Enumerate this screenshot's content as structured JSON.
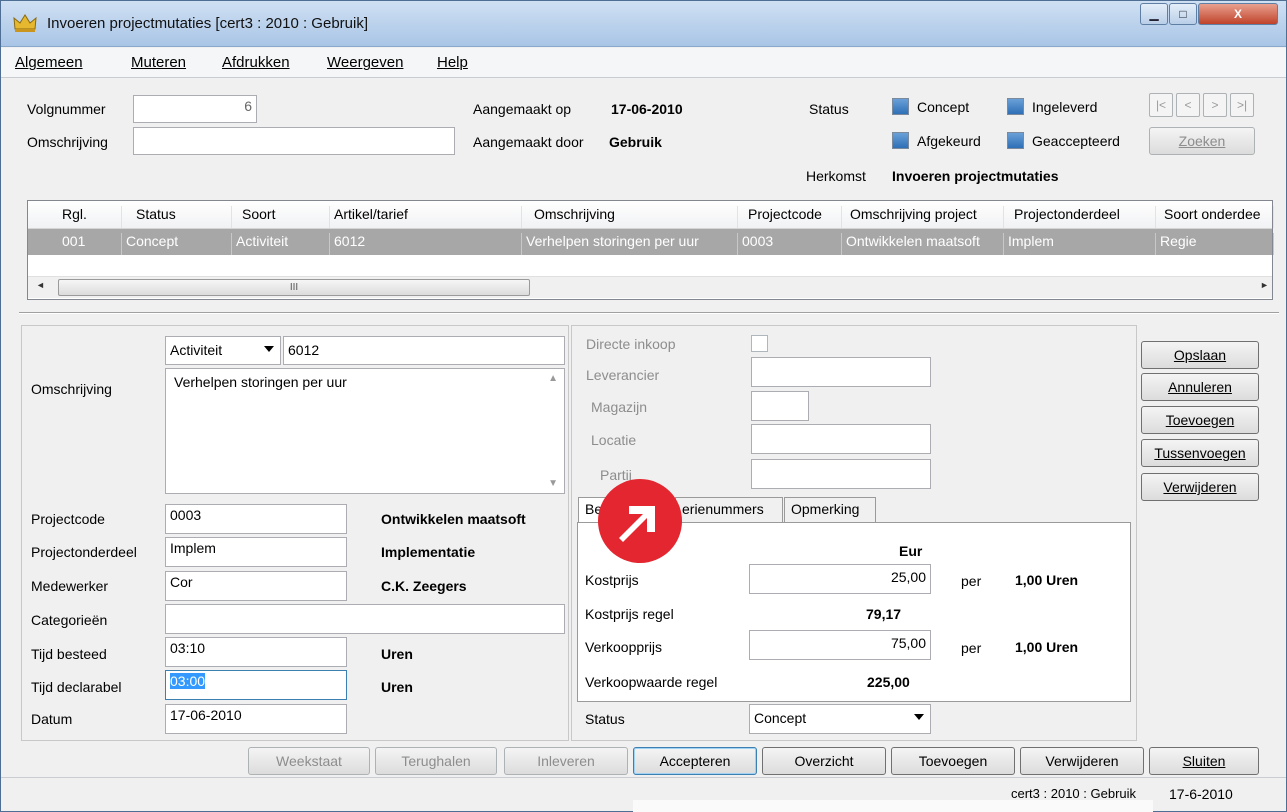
{
  "window": {
    "title": "Invoeren projectmutaties  [cert3 : 2010 : Gebruik]",
    "min_glyph": "▁",
    "max_glyph": "□",
    "close_glyph": "X"
  },
  "menu": [
    "Algemeen",
    "Muteren",
    "Afdrukken",
    "Weergeven",
    "Help"
  ],
  "header": {
    "volgnummer_label": "Volgnummer",
    "volgnummer_value": "6",
    "omschrijving_label": "Omschrijving",
    "omschrijving_value": "",
    "aangemaakt_op_label": "Aangemaakt op",
    "aangemaakt_op_value": "17-06-2010",
    "aangemaakt_door_label": "Aangemaakt door",
    "aangemaakt_door_value": "Gebruik",
    "status_label": "Status",
    "status_options": [
      "Concept",
      "Ingeleverd",
      "Afgekeurd",
      "Geaccepteerd"
    ],
    "herkomst_label": "Herkomst",
    "herkomst_value": "Invoeren projectmutaties",
    "zoeken_label": "Zoeken",
    "nav_buttons": [
      "|<",
      "<",
      ">",
      ">|"
    ]
  },
  "grid": {
    "columns": [
      "Rgl.",
      "Status",
      "Soort",
      "Artikel/tarief",
      "Omschrijving",
      "Projectcode",
      "Omschrijving project",
      "Projectonderdeel",
      "Soort onderdee"
    ],
    "rows": [
      [
        "001",
        "Concept",
        "Activiteit",
        "6012",
        "Verhelpen storingen per uur",
        "0003",
        "Ontwikkelen maatsoft",
        "Implem",
        "Regie"
      ]
    ],
    "scroll_glyph": "III",
    "scroll_left": "◄",
    "scroll_right": "►"
  },
  "detail": {
    "soort_value": "Activiteit",
    "artikel_value": "6012",
    "omschrijving_label": "Omschrijving",
    "omschrijving_value": "Verhelpen storingen per uur",
    "projectcode_label": "Projectcode",
    "projectcode_value": "0003",
    "projectcode_desc": "Ontwikkelen maatsoft",
    "projectonderdeel_label": "Projectonderdeel",
    "projectonderdeel_value": "Implem",
    "projectonderdeel_desc": "Implementatie",
    "medewerker_label": "Medewerker",
    "medewerker_value": "Cor",
    "medewerker_desc": "C.K. Zeegers",
    "categorieen_label": "Categorieën",
    "categorieen_value": "",
    "tijd_besteed_label": "Tijd besteed",
    "tijd_besteed_value": "03:10",
    "tijd_besteed_unit": "Uren",
    "tijd_declarabel_label": "Tijd declarabel",
    "tijd_declarabel_value": "03:00",
    "tijd_declarabel_unit": "Uren",
    "datum_label": "Datum",
    "datum_value": "17-06-2010"
  },
  "inkoop": {
    "directe_inkoop_label": "Directe inkoop",
    "leverancier_label": "Leverancier",
    "magazijn_label": "Magazijn",
    "locatie_label": "Locatie",
    "partij_label": "Partij"
  },
  "tabs": [
    "Bed",
    "erienummers",
    "Opmerking"
  ],
  "amounts": {
    "currency": "Eur",
    "kostprijs_label": "Kostprijs",
    "kostprijs_value": "25,00",
    "per_label": "per",
    "kostprijs_unit": "1,00 Uren",
    "kostprijs_regel_label": "Kostprijs regel",
    "kostprijs_regel_value": "79,17",
    "verkoopprijs_label": "Verkoopprijs",
    "verkoopprijs_value": "75,00",
    "verkoopprijs_unit": "1,00 Uren",
    "verkoopwaarde_label": "Verkoopwaarde regel",
    "verkoopwaarde_value": "225,00",
    "status_label": "Status",
    "status_value": "Concept"
  },
  "side_buttons": [
    "Opslaan",
    "Annuleren",
    "Toevoegen",
    "Tussenvoegen",
    "Verwijderen"
  ],
  "bottom_buttons": [
    "Weekstaat",
    "Terughalen",
    "Inleveren",
    "Accepteren",
    "Overzicht",
    "Toevoegen",
    "Verwijderen",
    "Sluiten"
  ],
  "statusbar": {
    "context": "cert3 : 2010 : Gebruik",
    "date": "17-6-2010"
  },
  "colors": {
    "selected_row": "#a7a7a7",
    "logo_red": "#e3262f",
    "checkbox_blue": "#2e6fb6"
  }
}
